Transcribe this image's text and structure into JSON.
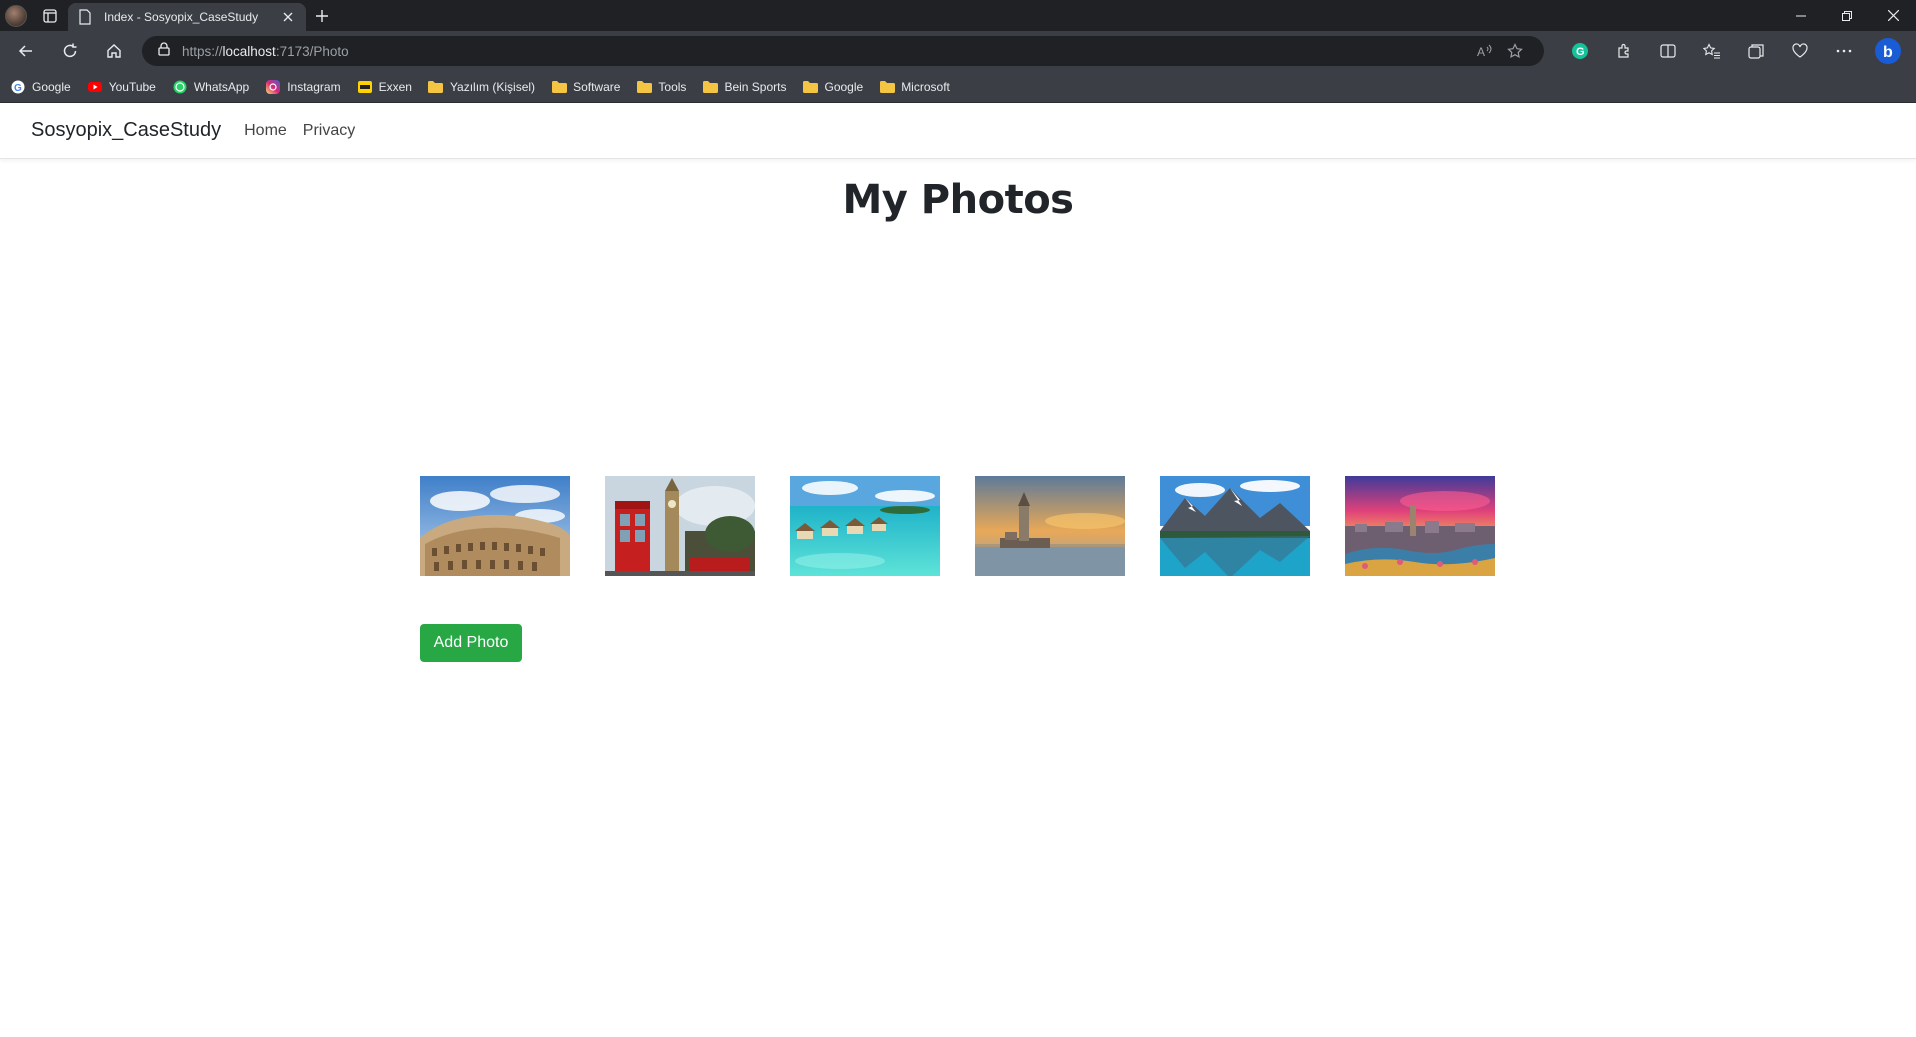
{
  "browser": {
    "tab_title": "Index - Sosyopix_CaseStudy",
    "url_prefix": "https://",
    "url_host": "localhost",
    "url_rest": ":7173/Photo",
    "bookmarks": [
      {
        "label": "Google",
        "icon": "google-icon"
      },
      {
        "label": "YouTube",
        "icon": "youtube-icon"
      },
      {
        "label": "WhatsApp",
        "icon": "whatsapp-icon"
      },
      {
        "label": "Instagram",
        "icon": "instagram-icon"
      },
      {
        "label": "Exxen",
        "icon": "exxen-icon"
      },
      {
        "label": "Yazılım (Kişisel)",
        "icon": "folder-icon"
      },
      {
        "label": "Software",
        "icon": "folder-icon"
      },
      {
        "label": "Tools",
        "icon": "folder-icon"
      },
      {
        "label": "Bein Sports",
        "icon": "folder-icon"
      },
      {
        "label": "Google",
        "icon": "folder-icon"
      },
      {
        "label": "Microsoft",
        "icon": "folder-icon"
      }
    ]
  },
  "site": {
    "brand": "Sosyopix_CaseStudy",
    "nav": [
      "Home",
      "Privacy"
    ],
    "title": "My Photos",
    "add_button": "Add Photo",
    "photos": [
      {
        "subject": "colosseum"
      },
      {
        "subject": "london-phone-booth-big-ben"
      },
      {
        "subject": "maldives-water-villas"
      },
      {
        "subject": "maidens-tower-sunset"
      },
      {
        "subject": "mountain-lake"
      },
      {
        "subject": "park-guell-sunset"
      }
    ]
  },
  "colors": {
    "accent_green": "#28a745",
    "chrome_dark": "#202124",
    "chrome_mid": "#3b3f45"
  }
}
